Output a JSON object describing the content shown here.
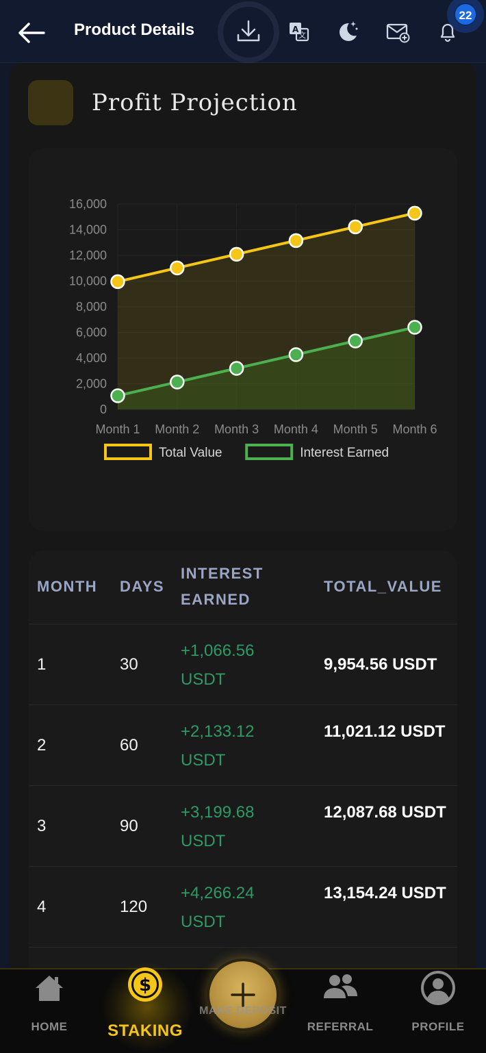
{
  "header": {
    "title": "Product Details",
    "notification_count": "22",
    "icons": [
      "back-arrow-icon",
      "download-icon",
      "translate-icon",
      "dark-mode-icon",
      "mail-add-icon",
      "bell-icon"
    ]
  },
  "card": {
    "title": "Profit Projection"
  },
  "chart_data": {
    "type": "line",
    "x": [
      "Month 1",
      "Month 2",
      "Month 3",
      "Month 4",
      "Month 5",
      "Month 6"
    ],
    "ylim": [
      0,
      16000
    ],
    "yticks": [
      "16,000",
      "14,000",
      "12,000",
      "10,000",
      "8,000",
      "6,000",
      "4,000",
      "2,000",
      "0"
    ],
    "legend_position": "bottom",
    "series": [
      {
        "name": "Total Value",
        "color": "#f5c518",
        "values": [
          9954.56,
          11021.12,
          12087.68,
          13154.24,
          14220.8,
          15287.36
        ]
      },
      {
        "name": "Interest Earned",
        "color": "#4caf50",
        "values": [
          1066.56,
          2133.12,
          3199.68,
          4266.24,
          5332.8,
          6399.36
        ]
      }
    ]
  },
  "table": {
    "headers": {
      "month": "MONTH",
      "days": "DAYS",
      "interest": "INTEREST EARNED",
      "total": "TOTAL_VALUE"
    },
    "rows": [
      {
        "month": "1",
        "days": "30",
        "interest": "+1,066.56 USDT",
        "total": "9,954.56 USDT"
      },
      {
        "month": "2",
        "days": "60",
        "interest": "+2,133.12 USDT",
        "total": "11,021.12 USDT"
      },
      {
        "month": "3",
        "days": "90",
        "interest": "+3,199.68 USDT",
        "total": "12,087.68 USDT"
      },
      {
        "month": "4",
        "days": "120",
        "interest": "+4,266.24 USDT",
        "total": "13,154.24 USDT"
      }
    ]
  },
  "nav": {
    "home": "HOME",
    "staking": "STAKING",
    "deposit": "MAKE DEPOSIT",
    "referral": "REFERRAL",
    "profile": "PROFILE",
    "active": "staking",
    "active_color": "#f5c518"
  }
}
